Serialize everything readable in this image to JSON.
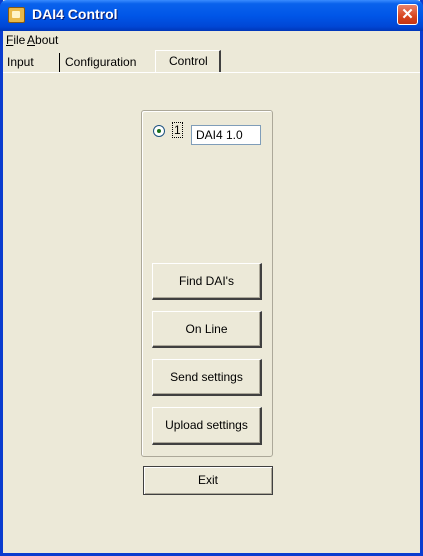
{
  "window": {
    "title": "DAI4 Control",
    "close_glyph": "✕"
  },
  "menu": [
    {
      "label": "File",
      "accel": "F",
      "rest": "ile"
    },
    {
      "label": "About",
      "accel": "A",
      "rest": "bout"
    }
  ],
  "tabs": [
    {
      "label": "Input",
      "active": false
    },
    {
      "label": "Configuration",
      "active": false
    },
    {
      "label": "Control",
      "active": true
    }
  ],
  "control": {
    "device_option": {
      "label": "1",
      "selected": true
    },
    "device_name_value": "DAI4 1.0",
    "buttons": {
      "find": "Find DAI's",
      "online": "On Line",
      "send": "Send settings",
      "upload": "Upload settings",
      "exit": "Exit"
    }
  }
}
